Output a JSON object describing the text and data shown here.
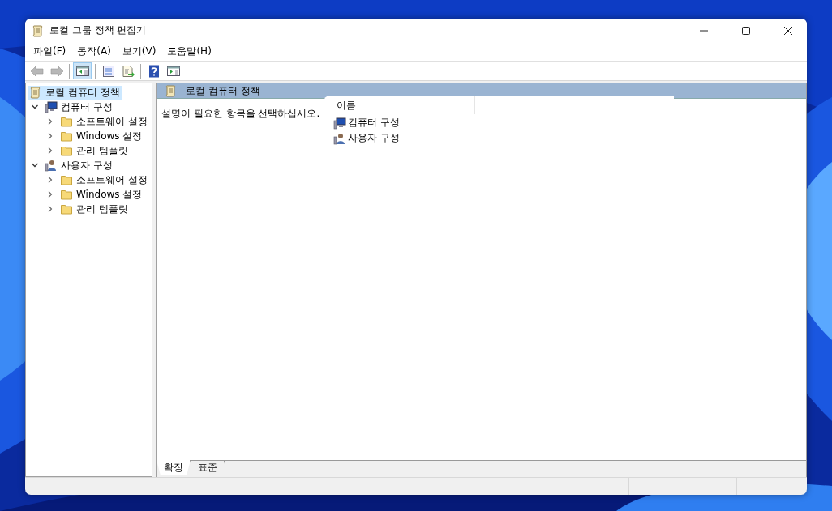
{
  "window": {
    "title": "로컬 그룹 정책 편집기"
  },
  "menu": [
    "파일(F)",
    "동작(A)",
    "보기(V)",
    "도움말(H)"
  ],
  "toolbar": [
    {
      "kind": "back",
      "disabled": true,
      "pressed": false
    },
    {
      "kind": "forward",
      "disabled": true,
      "pressed": false
    },
    {
      "kind": "separator"
    },
    {
      "kind": "tree-toggle",
      "disabled": false,
      "pressed": true
    },
    {
      "kind": "separator"
    },
    {
      "kind": "properties",
      "disabled": false,
      "pressed": false
    },
    {
      "kind": "export",
      "disabled": false,
      "pressed": false
    },
    {
      "kind": "separator"
    },
    {
      "kind": "help",
      "disabled": false,
      "pressed": false
    },
    {
      "kind": "action-pane",
      "disabled": false,
      "pressed": false
    }
  ],
  "tree": [
    {
      "label": "로컬 컴퓨터 정책",
      "kind": "policy",
      "selected": true,
      "children": [
        {
          "label": "컴퓨터 구성",
          "kind": "computer",
          "selected": false,
          "expanded": true,
          "children": [
            {
              "label": "소프트웨어 설정",
              "kind": "folder",
              "selected": false,
              "expanded": false
            },
            {
              "label": "Windows 설정",
              "kind": "folder",
              "selected": false,
              "expanded": false
            },
            {
              "label": "관리 템플릿",
              "kind": "folder",
              "selected": false,
              "expanded": false
            }
          ]
        },
        {
          "label": "사용자 구성",
          "kind": "user",
          "selected": false,
          "expanded": true,
          "children": [
            {
              "label": "소프트웨어 설정",
              "kind": "folder",
              "selected": false,
              "expanded": false
            },
            {
              "label": "Windows 설정",
              "kind": "folder",
              "selected": false,
              "expanded": false
            },
            {
              "label": "관리 템플릿",
              "kind": "folder",
              "selected": false,
              "expanded": false
            }
          ]
        }
      ]
    }
  ],
  "content": {
    "header": "로컬 컴퓨터 정책",
    "description": "설명이 필요한 항목을 선택하십시오.",
    "column": "이름",
    "items": [
      {
        "label": "컴퓨터 구성",
        "kind": "computer"
      },
      {
        "label": "사용자 구성",
        "kind": "user"
      }
    ]
  },
  "tabs": [
    {
      "label": "확장",
      "selected": true
    },
    {
      "label": "표준",
      "selected": false
    }
  ]
}
